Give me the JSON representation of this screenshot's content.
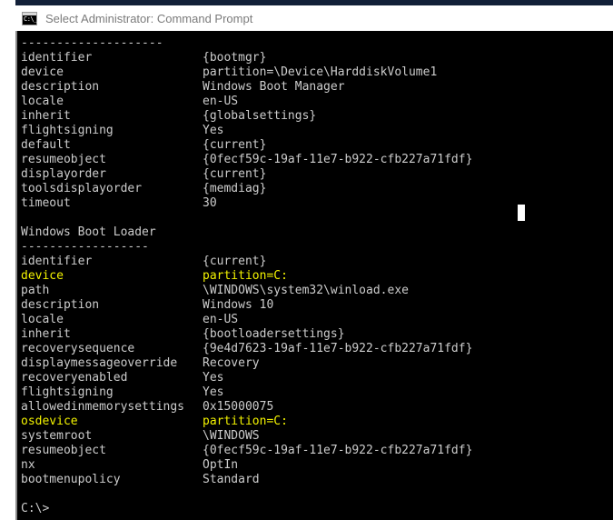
{
  "window": {
    "title": "Select Administrator: Command Prompt",
    "icon": "command-prompt-icon",
    "icon_glyph": "C:\\_"
  },
  "colors": {
    "background": "#000000",
    "foreground": "#cccccc",
    "highlight": "#f2f200",
    "marker": "#f5f500",
    "titlebar_bg": "#ffffff",
    "titlebar_text": "#7b7b7b",
    "top_strip": "#122038"
  },
  "terminal": {
    "prompt": "C:\\>",
    "cursor_visible": true,
    "lines": [
      {
        "type": "rule",
        "text": "--------------------"
      },
      {
        "type": "pair",
        "key": "identifier",
        "value": "{bootmgr}"
      },
      {
        "type": "pair",
        "key": "device",
        "value": "partition=\\Device\\HarddiskVolume1"
      },
      {
        "type": "pair",
        "key": "description",
        "value": "Windows Boot Manager"
      },
      {
        "type": "pair",
        "key": "locale",
        "value": "en-US"
      },
      {
        "type": "pair",
        "key": "inherit",
        "value": "{globalsettings}"
      },
      {
        "type": "pair",
        "key": "flightsigning",
        "value": "Yes"
      },
      {
        "type": "pair",
        "key": "default",
        "value": "{current}"
      },
      {
        "type": "pair",
        "key": "resumeobject",
        "value": "{0fecf59c-19af-11e7-b922-cfb227a71fdf}"
      },
      {
        "type": "pair",
        "key": "displayorder",
        "value": "{current}"
      },
      {
        "type": "pair",
        "key": "toolsdisplayorder",
        "value": "{memdiag}"
      },
      {
        "type": "pair",
        "key": "timeout",
        "value": "30"
      },
      {
        "type": "blank",
        "text": ""
      },
      {
        "type": "heading",
        "text": "Windows Boot Loader"
      },
      {
        "type": "rule",
        "text": "------------------"
      },
      {
        "type": "pair",
        "key": "identifier",
        "value": "{current}"
      },
      {
        "type": "pair",
        "key": "device",
        "value": "partition=C:",
        "highlight": true,
        "marker": true
      },
      {
        "type": "pair",
        "key": "path",
        "value": "\\WINDOWS\\system32\\winload.exe"
      },
      {
        "type": "pair",
        "key": "description",
        "value": "Windows 10"
      },
      {
        "type": "pair",
        "key": "locale",
        "value": "en-US"
      },
      {
        "type": "pair",
        "key": "inherit",
        "value": "{bootloadersettings}"
      },
      {
        "type": "pair",
        "key": "recoverysequence",
        "value": "{9e4d7623-19af-11e7-b922-cfb227a71fdf}"
      },
      {
        "type": "pair",
        "key": "displaymessageoverride",
        "value": "Recovery"
      },
      {
        "type": "pair",
        "key": "recoveryenabled",
        "value": "Yes"
      },
      {
        "type": "pair",
        "key": "flightsigning",
        "value": "Yes"
      },
      {
        "type": "pair",
        "key": "allowedinmemorysettings",
        "value": "0x15000075"
      },
      {
        "type": "pair",
        "key": "osdevice",
        "value": "partition=C:",
        "highlight": true,
        "marker": true
      },
      {
        "type": "pair",
        "key": "systemroot",
        "value": "\\WINDOWS"
      },
      {
        "type": "pair",
        "key": "resumeobject",
        "value": "{0fecf59c-19af-11e7-b922-cfb227a71fdf}"
      },
      {
        "type": "pair",
        "key": "nx",
        "value": "OptIn"
      },
      {
        "type": "pair",
        "key": "bootmenupolicy",
        "value": "Standard"
      },
      {
        "type": "blank",
        "text": ""
      },
      {
        "type": "prompt",
        "text": "C:\\>"
      }
    ]
  }
}
